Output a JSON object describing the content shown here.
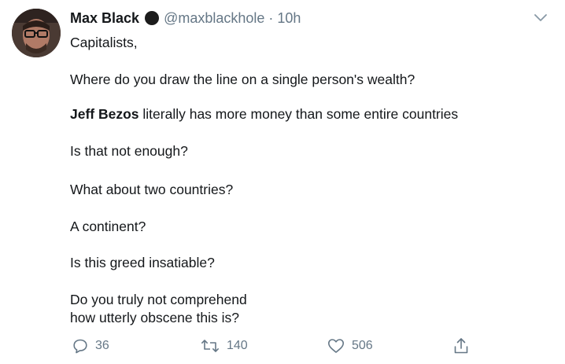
{
  "tweet": {
    "author": {
      "name": "Max Black",
      "handle": "@maxblackhole",
      "separator": "·",
      "time": "10h"
    },
    "lines": [
      "Capitalists,",
      "Where do you draw the line on a single person's wealth?",
      {
        "bold": "Jeff Bezos",
        "rest": " literally has more money than some entire countries"
      },
      "Is that not enough?",
      "What about two countries?",
      "A continent?",
      "Is this greed insatiable?",
      "Do you truly not comprehend",
      "how utterly obscene this is?"
    ],
    "actions": {
      "reply_count": "36",
      "retweet_count": "140",
      "like_count": "506"
    }
  },
  "icons": {
    "avatar": "avatar-photo",
    "verified_dot": "black-circle-icon",
    "menu": "chevron-down-icon",
    "reply": "reply-icon",
    "retweet": "retweet-icon",
    "like": "heart-icon",
    "share": "share-icon"
  },
  "colors": {
    "text": "#14171a",
    "muted": "#657786",
    "background": "#ffffff"
  }
}
